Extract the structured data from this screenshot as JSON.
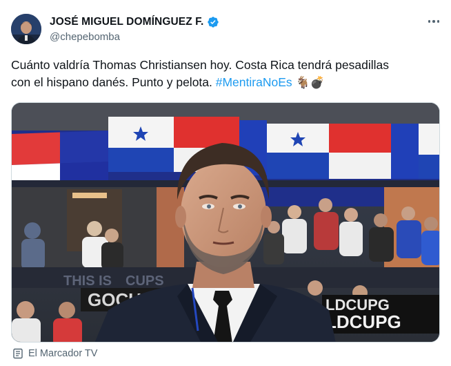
{
  "author": {
    "display_name": "JOSÉ MIGUEL DOMÍNGUEZ F.",
    "handle": "@chepebomba",
    "verified": true
  },
  "tweet": {
    "text_line1": "Cuánto valdría Thomas Christiansen hoy. Costa Rica tendrá pesadillas",
    "text_line2": "con el hispano danés. Punto y pelota. ",
    "hashtag": "#MentiraNoEs",
    "emojis": "🐐💣"
  },
  "media": {
    "banner_left": "THIS IS",
    "banner_right": "CUPS",
    "board_text_1": "LDCUPG",
    "board_text_2": "LDCUPG",
    "board_text_left": "GOCU"
  },
  "source": {
    "label": "El Marcador TV"
  },
  "icons": {
    "verified": "verified-badge-icon",
    "more": "more-options-icon",
    "source": "document-icon"
  },
  "colors": {
    "link": "#1d9bf0",
    "secondary_text": "#536471",
    "verified_blue": "#1d9bf0"
  }
}
